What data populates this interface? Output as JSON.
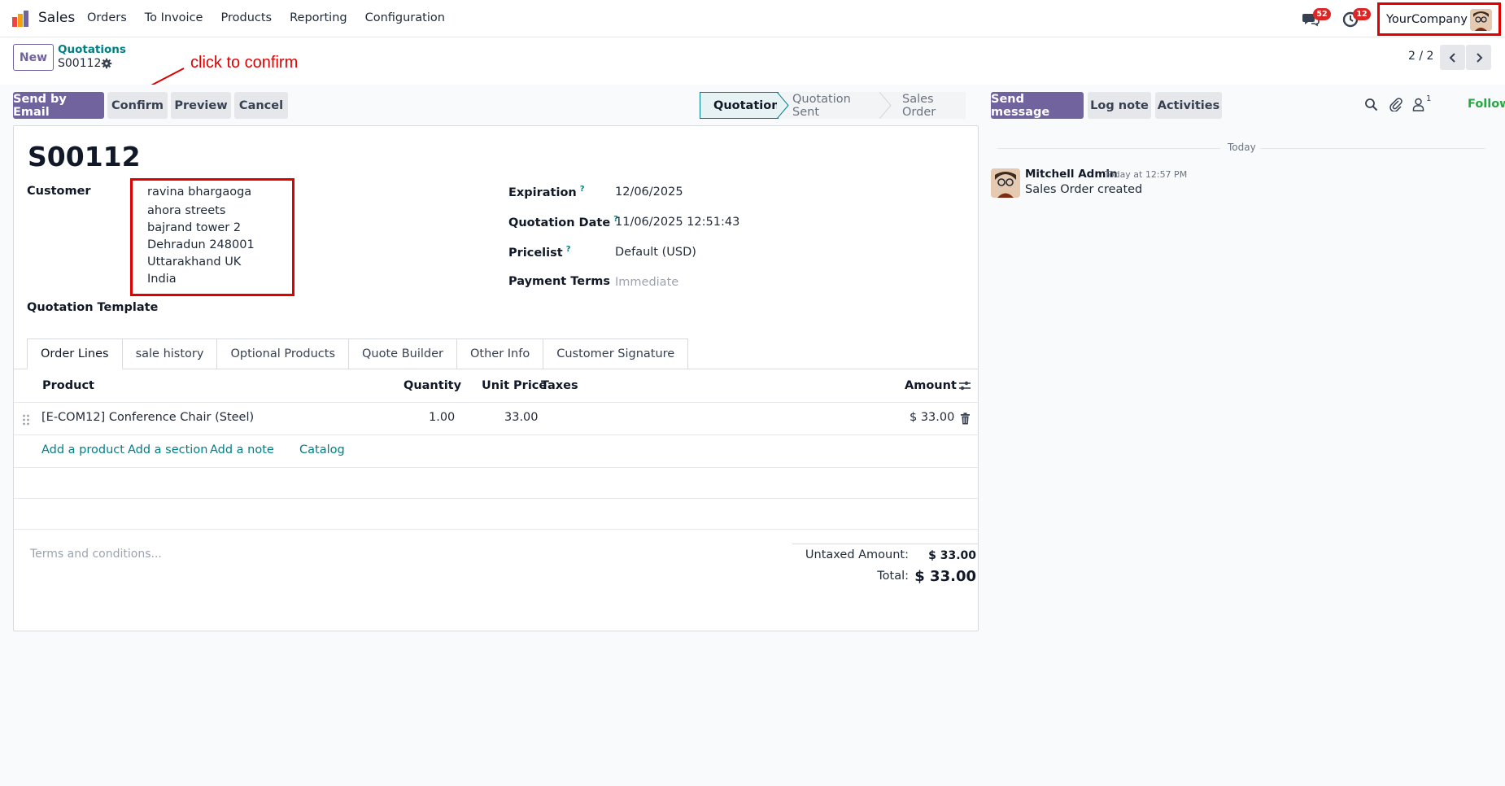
{
  "app": {
    "name": "Sales"
  },
  "menu": [
    "Orders",
    "To Invoice",
    "Products",
    "Reporting",
    "Configuration"
  ],
  "systray": {
    "messages_count": "52",
    "activities_count": "12",
    "company": "YourCompany"
  },
  "breadcrumb": {
    "parent": "Quotations",
    "current": "S00112"
  },
  "new_button": "New",
  "annotation": "click to confirm",
  "pager": "2 / 2",
  "actions": {
    "send_email": "Send by Email",
    "confirm": "Confirm",
    "preview": "Preview",
    "cancel": "Cancel"
  },
  "statusbar": [
    "Quotation",
    "Quotation Sent",
    "Sales Order"
  ],
  "form": {
    "number": "S00112",
    "customer_label": "Customer",
    "customer_address": [
      "ravina bhargaoga",
      "ahora streets",
      "bajrand tower 2",
      "Dehradun 248001",
      "Uttarakhand UK",
      "India"
    ],
    "template_label": "Quotation Template",
    "expiration_label": "Expiration",
    "expiration_value": "12/06/2025",
    "qdate_label": "Quotation Date",
    "qdate_value": "11/06/2025 12:51:43",
    "pricelist_label": "Pricelist",
    "pricelist_value": "Default (USD)",
    "terms_label": "Payment Terms",
    "terms_value": "Immediate",
    "help_mark": "?"
  },
  "tabs": [
    "Order Lines",
    "sale history",
    "Optional Products",
    "Quote Builder",
    "Other Info",
    "Customer Signature"
  ],
  "table": {
    "headers": {
      "product": "Product",
      "quantity": "Quantity",
      "unit_price": "Unit Price",
      "taxes": "Taxes",
      "amount": "Amount"
    },
    "rows": [
      {
        "product": "[E-COM12] Conference Chair (Steel)",
        "quantity": "1.00",
        "unit_price": "33.00",
        "taxes": "",
        "amount": "$ 33.00"
      }
    ],
    "links": {
      "add_product": "Add a product",
      "add_section": "Add a section",
      "add_note": "Add a note",
      "catalog": "Catalog"
    }
  },
  "footer": {
    "terms_placeholder": "Terms and conditions...",
    "untaxed_label": "Untaxed Amount:",
    "untaxed_value": "$ 33.00",
    "total_label": "Total:",
    "total_value": "$ 33.00"
  },
  "chatter": {
    "send_message": "Send message",
    "log_note": "Log note",
    "activities": "Activities",
    "followers_count": "1",
    "following": "Following",
    "date_separator": "Today",
    "message": {
      "author": "Mitchell Admin",
      "time": "Today at 12:57 PM",
      "body": "Sales Order created"
    }
  },
  "colors": {
    "primary": "#71639e",
    "teal": "#017e84",
    "annotation_red": "#e00000",
    "following_green": "#28a745",
    "badge_red": "#dc2626"
  },
  "icons": [
    "app-logo-icon",
    "messages-icon",
    "activities-clock-icon",
    "gear-icon",
    "chevron-left-icon",
    "chevron-right-icon",
    "drag-handle-icon",
    "trash-icon",
    "column-settings-icon",
    "search-icon",
    "paperclip-icon",
    "followers-icon"
  ]
}
